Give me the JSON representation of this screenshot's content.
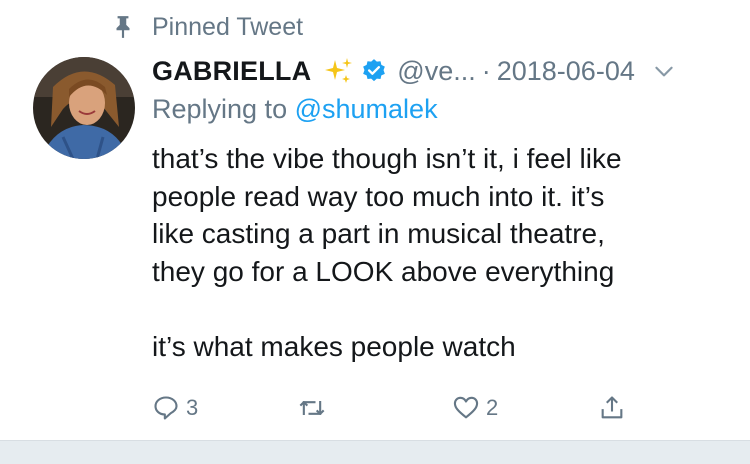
{
  "pinned": {
    "label": "Pinned Tweet",
    "icon": "pin-icon"
  },
  "author": {
    "name": "GABRIELLA",
    "handle": "@ve...",
    "avatar_icon": "avatar",
    "sparkles_icon": "sparkles-icon",
    "verified_icon": "verified-icon"
  },
  "meta": {
    "separator": "·",
    "date": "2018-06-04",
    "menu_icon": "chevron-down-icon"
  },
  "reply": {
    "prefix": "Replying to",
    "mention": "@shumalek"
  },
  "body": {
    "lines": [
      "that’s the vibe though isn’t it, i feel like",
      "people read way too much into it. it’s",
      "like casting a part in musical theatre,",
      "they go for a LOOK above everything",
      "",
      "it’s what makes people watch"
    ]
  },
  "actions": {
    "reply_count": "3",
    "retweet_count": "",
    "like_count": "2"
  },
  "colors": {
    "accent": "#1da1f2",
    "muted": "#657786",
    "text": "#14171a",
    "separator_bg": "#e6ecf0"
  }
}
